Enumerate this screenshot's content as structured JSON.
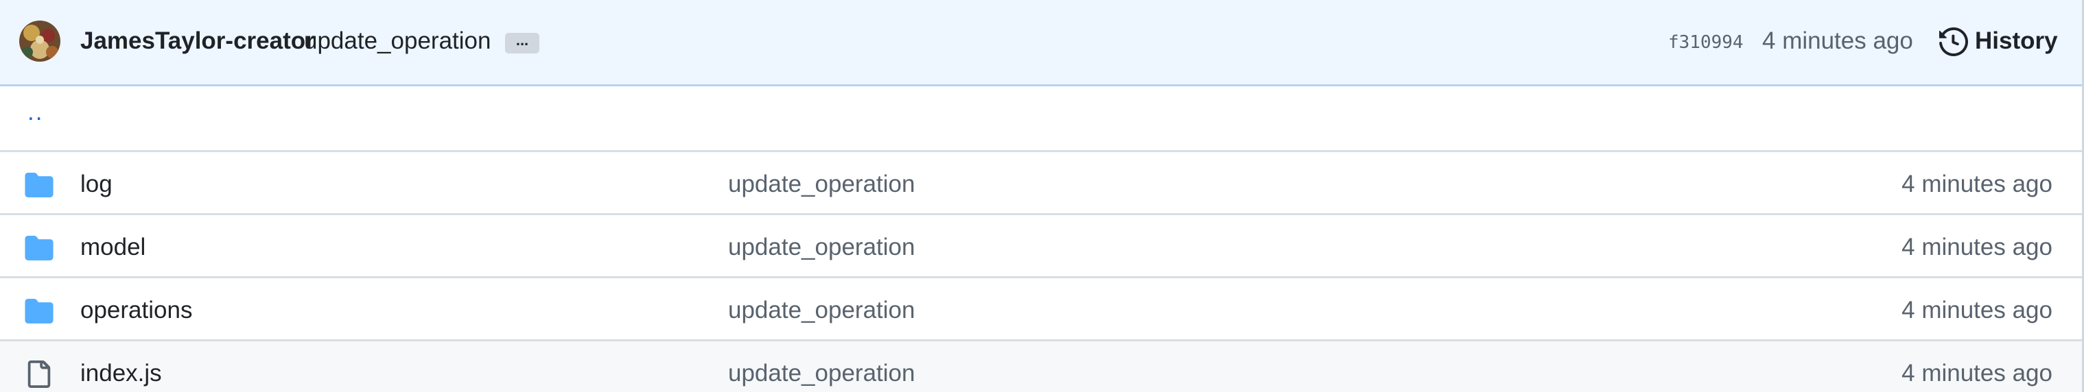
{
  "header": {
    "author": "JamesTaylor-creator",
    "commit_message": "update_operation",
    "ellipsis": "...",
    "sha": "f310994",
    "time": "4 minutes ago",
    "history_label": "History",
    "history_icon": "history-icon"
  },
  "parent_link": "..",
  "files": [
    {
      "type": "folder",
      "icon": "folder-icon",
      "name": "log",
      "message": "update_operation",
      "time": "4 minutes ago"
    },
    {
      "type": "folder",
      "icon": "folder-icon",
      "name": "model",
      "message": "update_operation",
      "time": "4 minutes ago"
    },
    {
      "type": "folder",
      "icon": "folder-icon",
      "name": "operations",
      "message": "update_operation",
      "time": "4 minutes ago"
    },
    {
      "type": "file",
      "icon": "file-icon",
      "name": "index.js",
      "message": "update_operation",
      "time": "4 minutes ago"
    }
  ],
  "colors": {
    "header_bg": "#eef6ff",
    "folder": "#54aeff",
    "link": "#0969da",
    "muted": "#59636e"
  }
}
